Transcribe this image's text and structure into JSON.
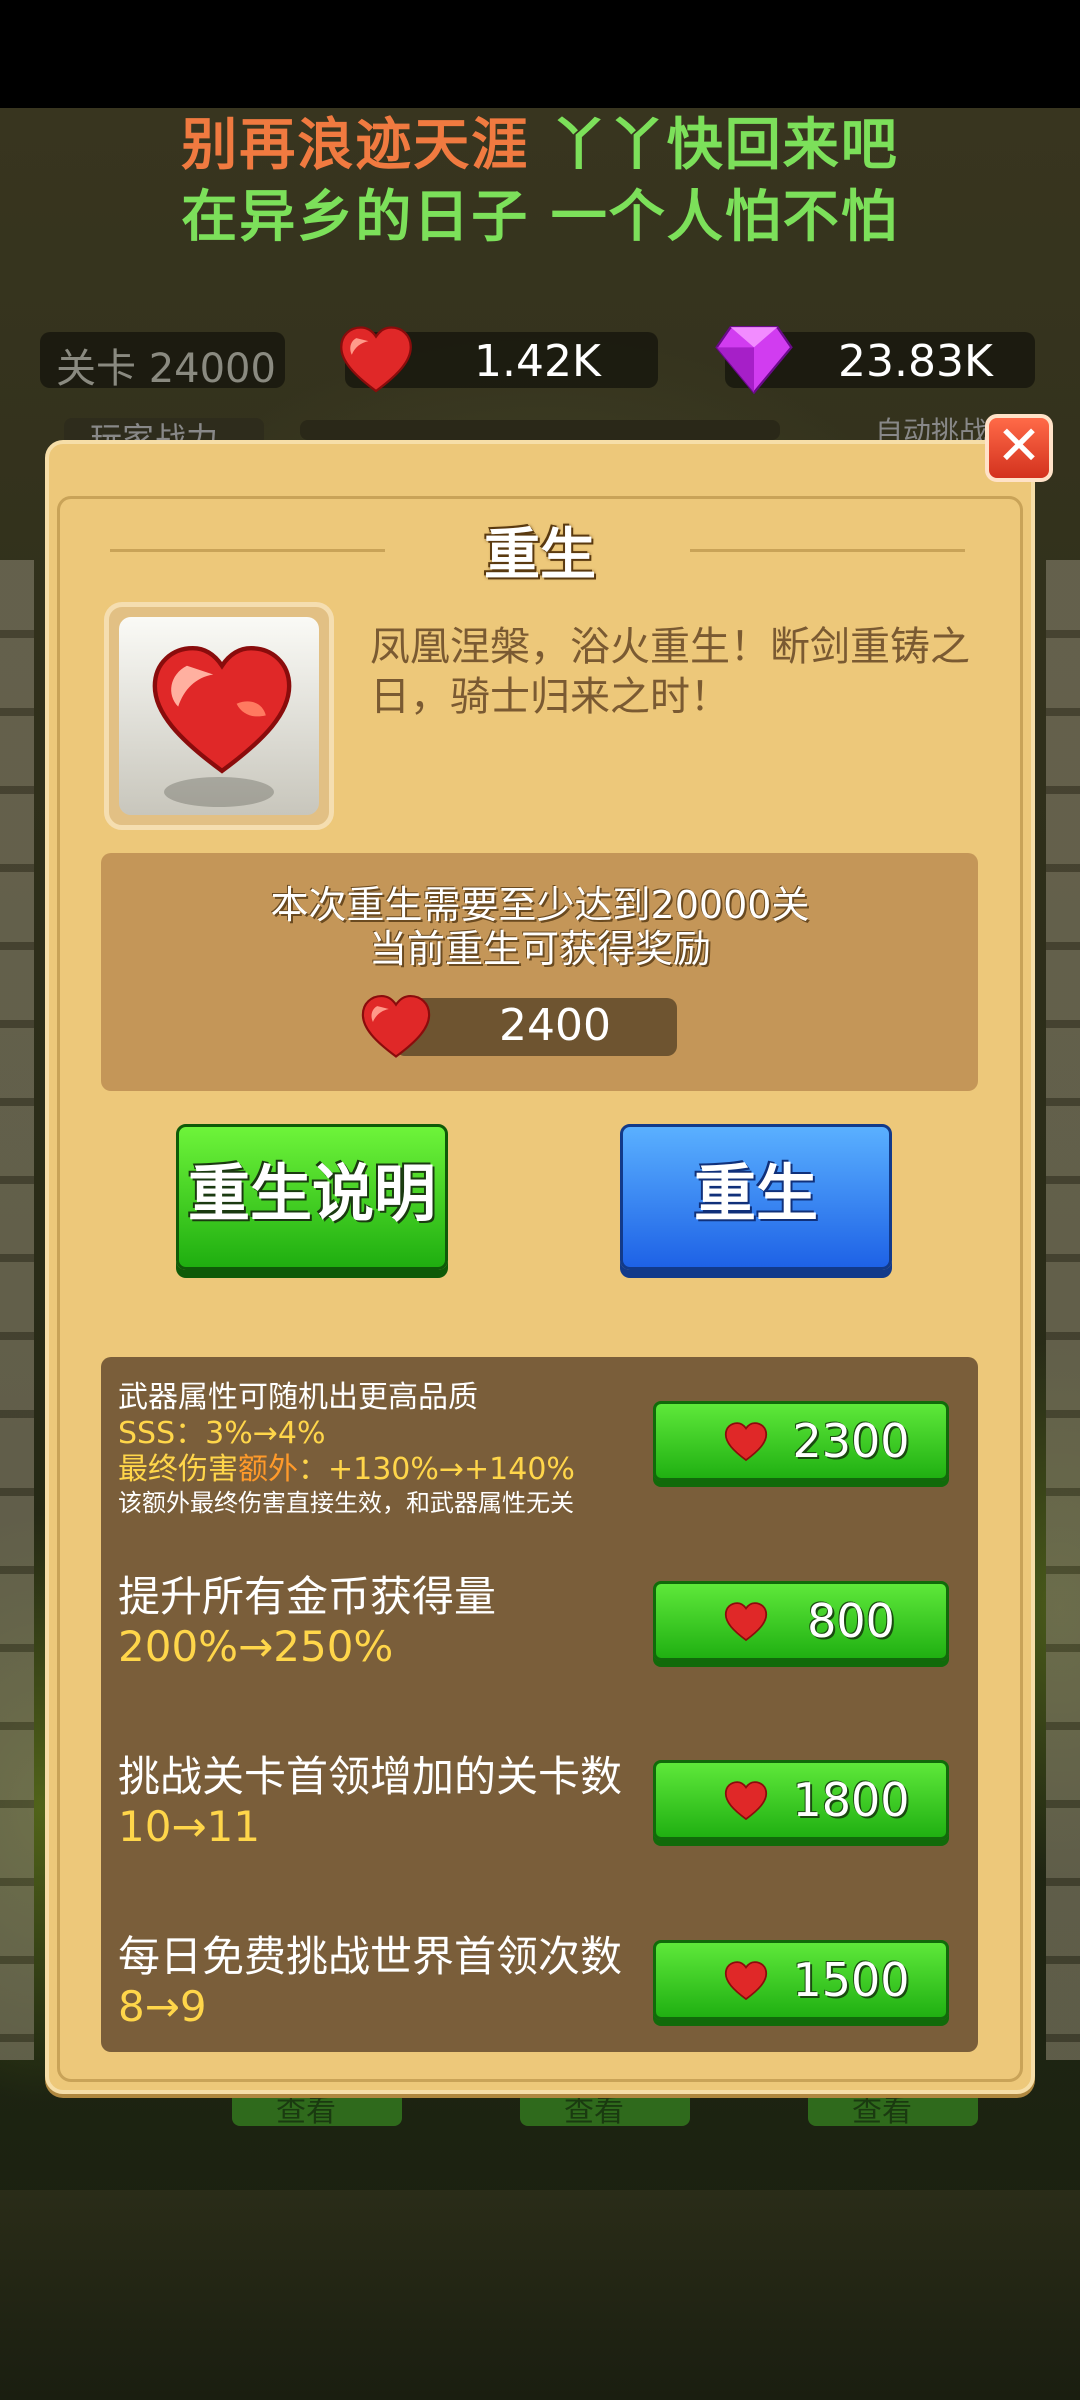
{
  "banner": {
    "line1_part1": "别再浪迹天涯",
    "line1_part2": "丫丫快回来吧",
    "line2": "在异乡的日子 一个人怕不怕"
  },
  "top_stats": {
    "stage": "关卡 24000",
    "hearts": "1.42K",
    "gems": "23.83K"
  },
  "background_peek": {
    "left_label": "玩家战力",
    "right_label": "自动挑战",
    "bottom_buttons": [
      "查看",
      "查看",
      "查看"
    ]
  },
  "dialog": {
    "close_symbol": "✕",
    "title": "重生",
    "description": "凤凰涅槃，浴火重生！断剑重铸之日，骑士归来之时！",
    "requirement_line1": "本次重生需要至少达到20000关",
    "requirement_line2": "当前重生可获得奖励",
    "reward_value": "2400",
    "explain_button": "重生说明",
    "rebirth_button": "重生"
  },
  "upgrades": [
    {
      "title": "武器属性可随机出更高品质",
      "line2": "SSS：3%→4%",
      "line3_a": "最终伤害",
      "line3_b": "额外",
      "line3_c": "：+130%→+140%",
      "note": "该额外最终伤害直接生效，和武器属性无关",
      "price": "2300"
    },
    {
      "title": "提升所有金币获得量",
      "value": "200%→250%",
      "price": "800"
    },
    {
      "title": "挑战关卡首领增加的关卡数",
      "value": "10→11",
      "price": "1800"
    },
    {
      "title": "每日免费挑战世界首领次数",
      "value": "8→9",
      "price": "1500"
    }
  ],
  "colors": {
    "panel": "#edc87a",
    "green_button": "#2bc318",
    "blue_button": "#2f7cf0",
    "value_yellow": "#ffd64a",
    "extra_orange": "#ff9a2a"
  },
  "icons": [
    "heart-icon",
    "gem-icon",
    "close-icon"
  ]
}
